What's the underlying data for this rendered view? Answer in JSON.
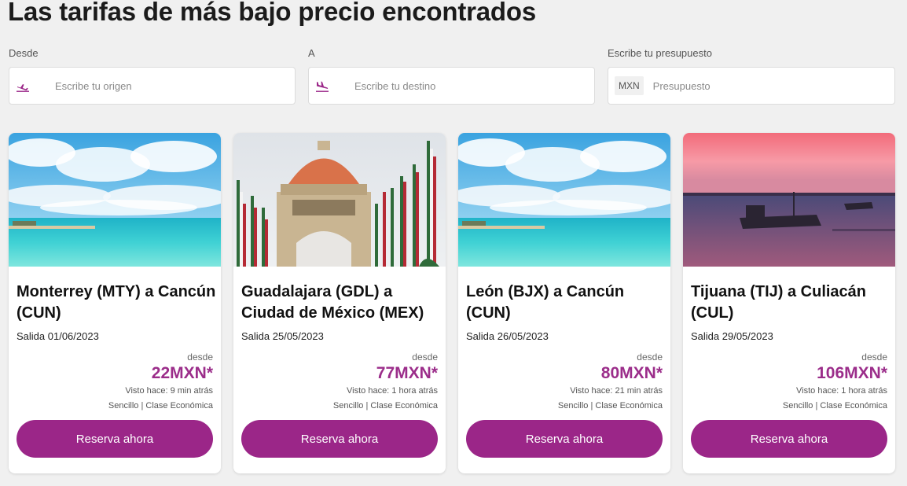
{
  "page": {
    "title": "Las tarifas de más bajo precio encontrados"
  },
  "search": {
    "origin": {
      "label": "Desde",
      "placeholder": "Escribe tu origen",
      "icon": "plane-takeoff-icon"
    },
    "destination": {
      "label": "A",
      "placeholder": "Escribe tu destino",
      "icon": "plane-landing-icon"
    },
    "budget": {
      "label": "Escribe tu presupuesto",
      "currency": "MXN",
      "placeholder": "Presupuesto"
    }
  },
  "colors": {
    "brand": "#9b2688",
    "price": "#9b2d8a"
  },
  "cards": [
    {
      "route": "Monterrey (MTY) a Cancún (CUN)",
      "departure": "Salida 01/06/2023",
      "from_label": "desde",
      "price": "22MXN*",
      "seen": "Visto hace: 9 min atrás",
      "fare_type": "Sencillo | Clase Económica",
      "cta": "Reserva ahora",
      "image": "beach-image"
    },
    {
      "route": "Guadalajara (GDL) a Ciudad de México (MEX)",
      "departure": "Salida 25/05/2023",
      "from_label": "desde",
      "price": "77MXN*",
      "seen": "Visto hace: 1 hora atrás",
      "fare_type": "Sencillo | Clase Económica",
      "cta": "Reserva ahora",
      "image": "monument-image"
    },
    {
      "route": "León (BJX) a Cancún (CUN)",
      "departure": "Salida 26/05/2023",
      "from_label": "desde",
      "price": "80MXN*",
      "seen": "Visto hace: 21 min atrás",
      "fare_type": "Sencillo | Clase Económica",
      "cta": "Reserva ahora",
      "image": "beach-image"
    },
    {
      "route": "Tijuana (TIJ) a Culiacán (CUL)",
      "departure": "Salida 29/05/2023",
      "from_label": "desde",
      "price": "106MXN*",
      "seen": "Visto hace: 1 hora atrás",
      "fare_type": "Sencillo | Clase Económica",
      "cta": "Reserva ahora",
      "image": "sunset-boat-image"
    }
  ]
}
